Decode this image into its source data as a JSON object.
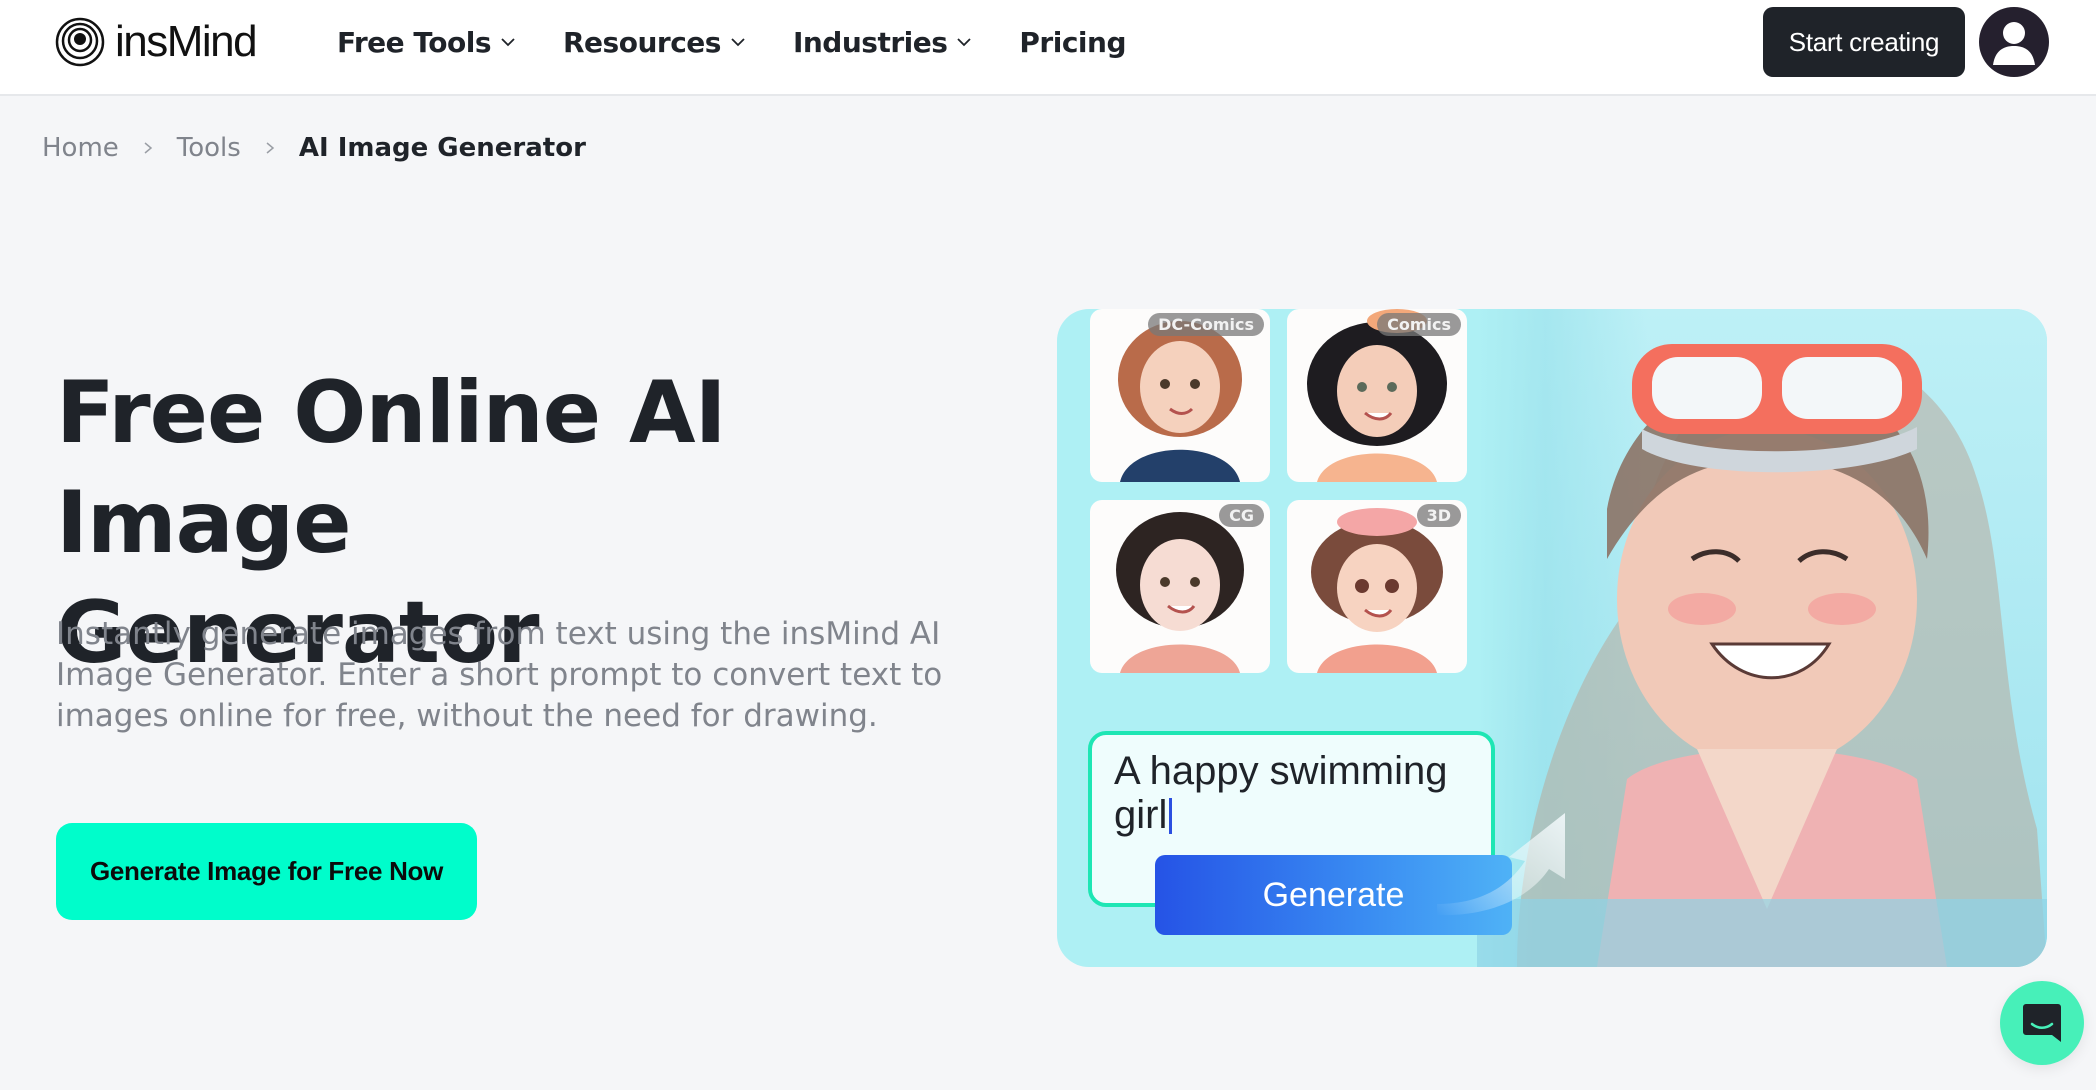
{
  "header": {
    "logo_text": "insMind",
    "nav": [
      {
        "label": "Free Tools",
        "has_dropdown": true
      },
      {
        "label": "Resources",
        "has_dropdown": true
      },
      {
        "label": "Industries",
        "has_dropdown": true
      },
      {
        "label": "Pricing",
        "has_dropdown": false
      }
    ],
    "start_button": "Start creating",
    "avatar_icon": "user-avatar-icon"
  },
  "breadcrumb": [
    {
      "label": "Home",
      "current": false
    },
    {
      "label": "Tools",
      "current": false
    },
    {
      "label": "AI Image Generator",
      "current": true
    }
  ],
  "hero": {
    "title_line1": "Free Online AI Image",
    "title_line2": "Generator",
    "description": "Instantly generate images from text using the insMind AI Image Generator. Enter a short prompt to convert text to images online for free, without the need for drawing.",
    "cta_label": "Generate Image for Free Now"
  },
  "showcase": {
    "style_thumbs": [
      {
        "tag": "DC-Comics"
      },
      {
        "tag": "Comics"
      },
      {
        "tag": "CG"
      },
      {
        "tag": "3D"
      }
    ],
    "prompt_text": "A happy swimming girl",
    "generate_label": "Generate"
  },
  "chat": {
    "icon": "chat-bubble-icon"
  },
  "colors": {
    "accent": "#00fdcb",
    "dark": "#1f2329",
    "panel_bg": "#aef0f4",
    "generate_gradient_start": "#2553e6",
    "generate_gradient_end": "#4fb2f6",
    "chat_bg": "#47f0b9"
  }
}
